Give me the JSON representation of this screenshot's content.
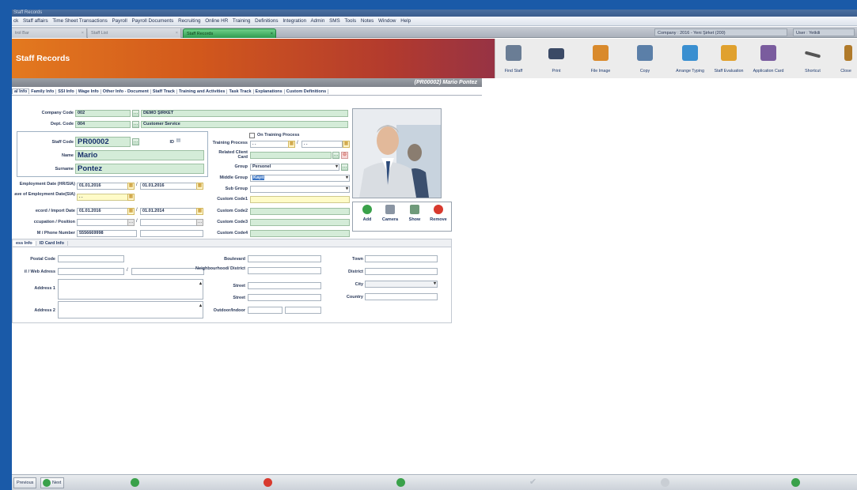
{
  "window": {
    "title": "Staff Records"
  },
  "menu": [
    "ck",
    "Staff affairs",
    "Time Sheet Transactions",
    "Payroll",
    "Payroll Documents",
    "Recruiting",
    "Online HR",
    "Training",
    "Definitions",
    "Integration",
    "Admin",
    "SMS",
    "Tools",
    "Notes",
    "Window",
    "Help"
  ],
  "doc_tabs": [
    {
      "label": "trol Bar",
      "close": "×"
    },
    {
      "label": "Staff List",
      "close": "×"
    },
    {
      "label": "Staff Records",
      "close": "×"
    }
  ],
  "status": {
    "company": "Company : 2016 - Yeni Şirket (200)",
    "user": "User : Yetkili"
  },
  "header": {
    "title": "Staff Records"
  },
  "toolbar": [
    {
      "label": "Find Staff",
      "icon": "find-staff-icon",
      "color": "#6a7d95"
    },
    {
      "label": "Print",
      "icon": "printer-icon",
      "color": "#3b4a66"
    },
    {
      "label": "File Image",
      "icon": "file-image-icon",
      "color": "#d98a2c"
    },
    {
      "label": "Copy",
      "icon": "copy-people-icon",
      "color": "#5b7fa8"
    },
    {
      "label": "Arrange Typing",
      "icon": "arrange-typing-icon",
      "color": "#3a8fd0"
    },
    {
      "label": "Staff Evaluation",
      "icon": "staff-evaluation-icon",
      "color": "#e0a12e"
    },
    {
      "label": "Application Card",
      "icon": "application-card-icon",
      "color": "#7a5c9e"
    },
    {
      "label": "Shortcut",
      "icon": "shortcut-icon",
      "color": "#555555"
    },
    {
      "label": "Close",
      "icon": "close-door-icon",
      "color": "#b07a2a"
    }
  ],
  "staff_header": "(PR00002) Mario Pontez",
  "form_tabs": [
    "al Info",
    "Family Info",
    "SSI Info",
    "Wage Info",
    "Other Info - Document",
    "Staff Track",
    "Training and Activities",
    "Task Track",
    "Explanations",
    "Custom Definitions"
  ],
  "form": {
    "company_code_label": "Company Code",
    "company_code": "002",
    "company_name": "DEMO ŞİRKET",
    "dept_code_label": "Dept. Code",
    "dept_code": "004",
    "dept_name": "Customer Service",
    "staff_code_label": "Staff Code",
    "staff_code": "PR00002",
    "id_label": "ID",
    "name_label": "Name",
    "name": "Mario",
    "surname_label": "Surname",
    "surname": "Pontez",
    "employment_label": "Employment Date (HR/SIA)",
    "employment_1": "01.01.2016",
    "employment_2": "01.01.2016",
    "leave_label": "ave of Employment Date(SIA)",
    "leave": "  .  .",
    "record_label": "ecord / Import Date",
    "record_1": "01.01.2016",
    "record_2": "01.01.2014",
    "occupation_label": "ccupation / Position",
    "phone_label": "M / Phone Number",
    "phone": "5556669998"
  },
  "mid": {
    "on_training": "On Training Process",
    "training_label": "Training Process",
    "training_from": "  .  .",
    "training_to": "  .  .",
    "related_label": "Related Client Card",
    "group_label": "Group",
    "group": "Personel",
    "middle_label": "Middle Group",
    "middle": "Kayıt",
    "sub_label": "Sub Group",
    "cc1_label": "Custom Code1",
    "cc2_label": "Custom Code2",
    "cc3_label": "Custom Code3",
    "cc4_label": "Custom Code4"
  },
  "photo_buttons": [
    "Add",
    "Camera",
    "Show",
    "Remove"
  ],
  "sub_tabs": [
    "ess Info",
    "ID Card Info"
  ],
  "address": {
    "postal_label": "Postal Code",
    "mail_label": "il / Web Adress",
    "address1_label": "Address 1",
    "address2_label": "Address 2",
    "boulevard_label": "Boulevard",
    "neighbourhood_label": "Neighbourhood/ District",
    "street1_label": "Street",
    "street2_label": "Street",
    "outdoor_label": "Outdoor/Indoor",
    "town_label": "Town",
    "district_label": "District",
    "city_label": "City",
    "country_label": "Country"
  },
  "bottom": {
    "previous": "Previous",
    "next": "Next"
  }
}
